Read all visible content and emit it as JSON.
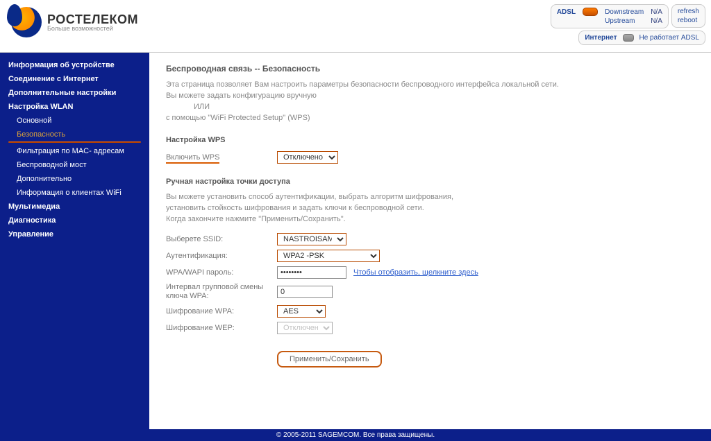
{
  "brand": {
    "name": "РОСТЕЛЕКОМ",
    "tagline": "Больше возможностей"
  },
  "status": {
    "adsl_label": "ADSL",
    "down_label": "Downstream",
    "down_val": "N/A",
    "up_label": "Upstream",
    "up_val": "N/A",
    "net_label": "Интернет",
    "net_val": "Не работает ADSL",
    "refresh": "refresh",
    "reboot": "reboot"
  },
  "nav": {
    "device": "Информация об устройстве",
    "conn": "Соединение с Интернет",
    "adv": "Дополнительные настройки",
    "wlan": "Настройка WLAN",
    "main": "Основной",
    "sec": "Безопасность",
    "mac": "Фильтрация по MAC- адресам",
    "bridge": "Беспроводной мост",
    "extra": "Дополнительно",
    "clients": "Информация о клиентах WiFi",
    "mm": "Мультимедиа",
    "diag": "Диагностика",
    "mgmt": "Управление"
  },
  "page": {
    "title": "Беспроводная связь -- Безопасность",
    "intro1": "Эта страница позволяет Вам настроить параметры безопасности беспроводного интерфейса локальной сети.",
    "intro2": "Вы можете задать конфигурацию вручную",
    "intro3": "ИЛИ",
    "intro4": "с помощью \"WiFi Protected Setup\" (WPS)",
    "wps_heading": "Настройка WPS",
    "wps_label": "Включить WPS",
    "wps_value": "Отключено",
    "manual_heading": "Ручная настройка точки доступа",
    "manual1": "Вы можете установить способ аутентификации, выбрать алгоритм шифрования,",
    "manual2": "установить стойкость шифрования и задать ключи к беспроводной сети.",
    "manual3": "Когда закончите нажмите \"Применить/Сохранить\".",
    "ssid_label": "Выберете SSID:",
    "ssid_value": "NASTROISAM.RU",
    "auth_label": "Аутентификация:",
    "auth_value": "WPA2 -PSK",
    "pw_label": "WPA/WAPI пароль:",
    "pw_value": "••••••••",
    "pw_link": "Чтобы отобразить, щелкните здесь",
    "interval_label": "Интервал групповой смены ключа WPA:",
    "interval_value": "0",
    "enc_label": "Шифрование WPA:",
    "enc_value": "AES",
    "wep_label": "Шифрование WEP:",
    "wep_value": "Отключено",
    "apply": "Применить/Сохранить"
  },
  "footer": "© 2005-2011 SAGEMCOM. Все права защищены."
}
